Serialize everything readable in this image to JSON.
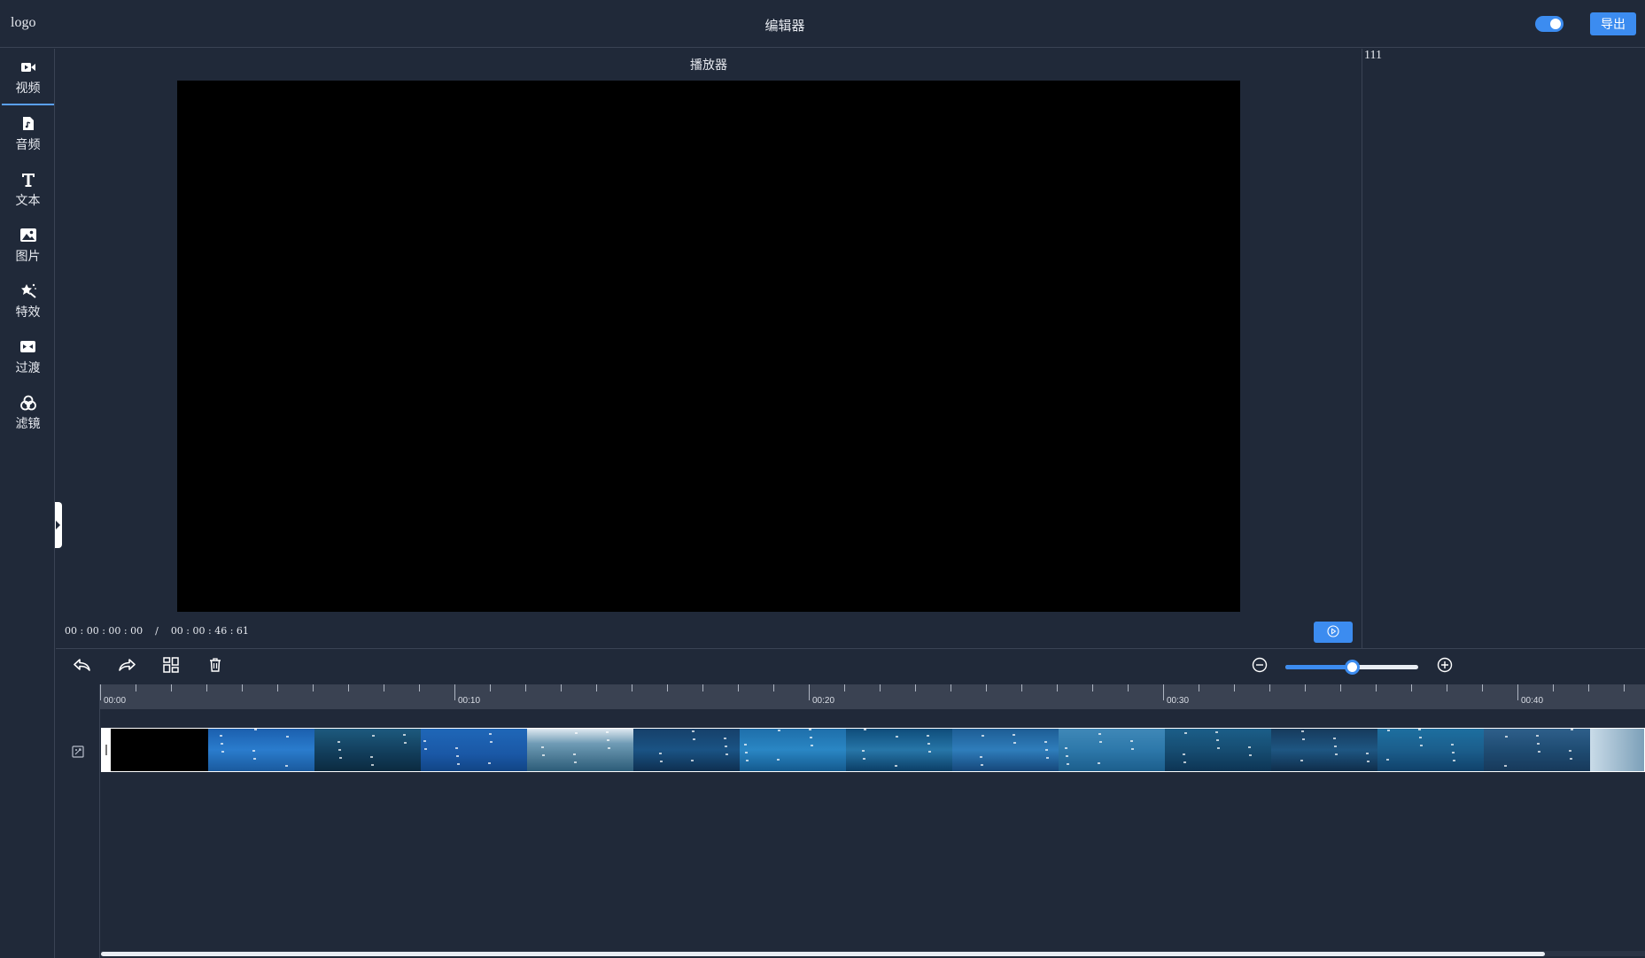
{
  "header": {
    "logo": "logo",
    "title": "编辑器",
    "toggle_on": true,
    "export_label": "导出"
  },
  "sidebar": {
    "items": [
      {
        "label": "视频",
        "icon": "video-camera-icon",
        "active": true
      },
      {
        "label": "音频",
        "icon": "audio-file-icon",
        "active": false
      },
      {
        "label": "文本",
        "icon": "text-icon",
        "active": false
      },
      {
        "label": "图片",
        "icon": "image-icon",
        "active": false
      },
      {
        "label": "特效",
        "icon": "effects-icon",
        "active": false
      },
      {
        "label": "过渡",
        "icon": "transition-icon",
        "active": false
      },
      {
        "label": "滤镜",
        "icon": "filter-icon",
        "active": false
      }
    ]
  },
  "player": {
    "title": "播放器",
    "current_time": "00 : 00 : 00 : 00",
    "separator": "/",
    "total_time": "00 : 00 : 46 : 61"
  },
  "right_panel": {
    "text": "111"
  },
  "toolbar": {
    "zoom_level": 0.5
  },
  "timeline": {
    "ruler_labels": [
      "00:00",
      "00:10",
      "00:20",
      "00:30",
      "00:40"
    ],
    "thumbnail_count": 14
  },
  "colors": {
    "background": "#202939",
    "accent": "#3c8cf0",
    "ruler": "#3a4252",
    "border": "#3a4354"
  }
}
